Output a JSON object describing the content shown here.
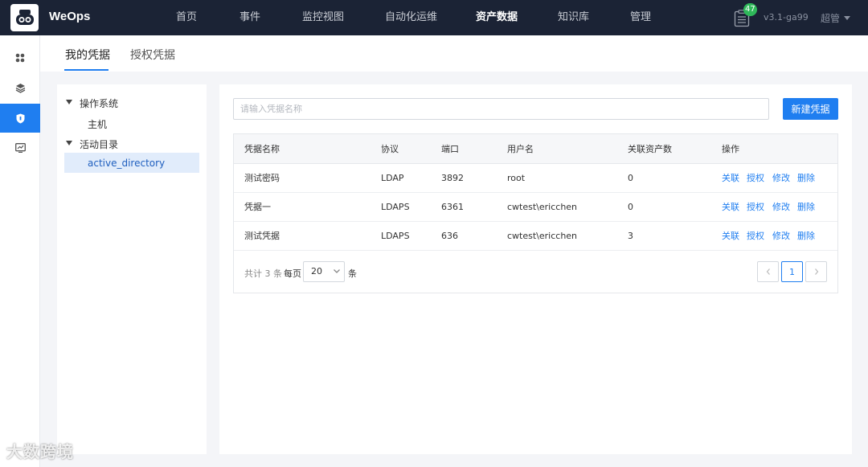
{
  "app": {
    "brand": "WeOps"
  },
  "nav": [
    {
      "label": "首页"
    },
    {
      "label": "事件"
    },
    {
      "label": "监控视图"
    },
    {
      "label": "自动化运维"
    },
    {
      "label": "资产数据"
    },
    {
      "label": "知识库"
    },
    {
      "label": "管理"
    }
  ],
  "header": {
    "badge_count": "47",
    "version": "v3.1-ga99",
    "user": "超管"
  },
  "tabs": [
    {
      "label": "我的凭据"
    },
    {
      "label": "授权凭据"
    }
  ],
  "tree": {
    "groups": [
      {
        "label": "操作系统",
        "children": [
          "主机"
        ]
      },
      {
        "label": "活动目录",
        "children": [
          "active_directory"
        ]
      }
    ]
  },
  "search": {
    "placeholder": "请输入凭据名称"
  },
  "toolbar": {
    "new_label": "新建凭据"
  },
  "table": {
    "columns": [
      "凭据名称",
      "协议",
      "端口",
      "用户名",
      "关联资产数",
      "操作"
    ],
    "rows": [
      {
        "name": "测试密码",
        "protocol": "LDAP",
        "port": "3892",
        "username": "root",
        "assets": "0"
      },
      {
        "name": "凭据一",
        "protocol": "LDAPS",
        "port": "6361",
        "username": "cwtest\\ericchen",
        "assets": "0"
      },
      {
        "name": "测试凭据",
        "protocol": "LDAPS",
        "port": "636",
        "username": "cwtest\\ericchen",
        "assets": "3"
      }
    ],
    "actions": [
      "关联",
      "授权",
      "修改",
      "删除"
    ]
  },
  "pagination": {
    "total": "共计 3 条",
    "per_page_label": "每页",
    "page_size": "20",
    "unit": "条",
    "current_page": "1"
  },
  "watermark": "大数跨境",
  "colors": {
    "topbar": "#1b2335",
    "accent": "#1f7ef0",
    "badge": "#2fb85a"
  }
}
